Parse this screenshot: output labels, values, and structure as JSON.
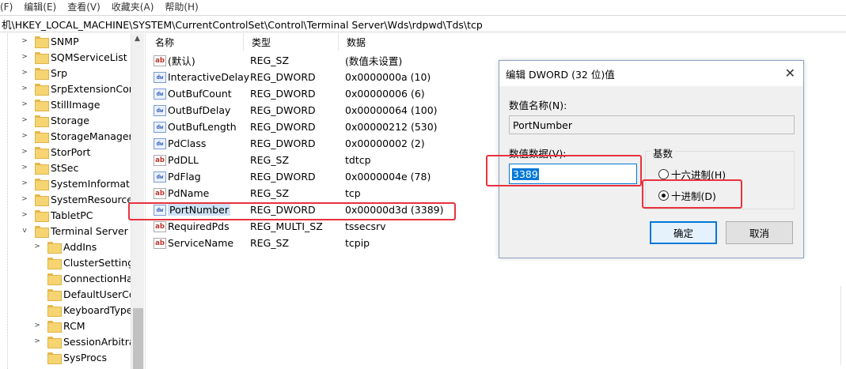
{
  "menu": [
    "(F)",
    "编辑(E)",
    "查看(V)",
    "收藏夹(A)",
    "帮助(H)"
  ],
  "address": "机\\HKEY_LOCAL_MACHINE\\SYSTEM\\CurrentControlSet\\Control\\Terminal Server\\Wds\\rdpwd\\Tds\\tcp",
  "tree": {
    "items": [
      {
        "label": "SNMP",
        "expander": ">"
      },
      {
        "label": "SQMServiceList",
        "expander": ">"
      },
      {
        "label": "Srp",
        "expander": ">"
      },
      {
        "label": "SrpExtensionConf",
        "expander": ">"
      },
      {
        "label": "StillImage",
        "expander": ">"
      },
      {
        "label": "Storage",
        "expander": ">"
      },
      {
        "label": "StorageManagem",
        "expander": ">"
      },
      {
        "label": "StorPort",
        "expander": ">"
      },
      {
        "label": "StSec",
        "expander": ">"
      },
      {
        "label": "SystemInformatio",
        "expander": ">"
      },
      {
        "label": "SystemResources",
        "expander": ">"
      },
      {
        "label": "TabletPC",
        "expander": ">"
      },
      {
        "label": "Terminal Server",
        "expander": "v"
      },
      {
        "label": "AddIns",
        "expander": ">"
      },
      {
        "label": "ClusterSettings",
        "expander": ""
      },
      {
        "label": "ConnectionHan",
        "expander": ""
      },
      {
        "label": "DefaultUserCor",
        "expander": ""
      },
      {
        "label": "KeyboardType",
        "expander": ""
      },
      {
        "label": "RCM",
        "expander": ">"
      },
      {
        "label": "SessionArbitrat",
        "expander": ">"
      },
      {
        "label": "SysProcs",
        "expander": ""
      }
    ]
  },
  "list": {
    "headers": {
      "name": "名称",
      "type": "类型",
      "data": "数据"
    },
    "rows": [
      {
        "icon": "ab",
        "name": "(默认)",
        "type": "REG_SZ",
        "data": "(数值未设置)"
      },
      {
        "icon": "dw",
        "name": "InteractiveDelay",
        "type": "REG_DWORD",
        "data": "0x0000000a (10)"
      },
      {
        "icon": "dw",
        "name": "OutBufCount",
        "type": "REG_DWORD",
        "data": "0x00000006 (6)"
      },
      {
        "icon": "dw",
        "name": "OutBufDelay",
        "type": "REG_DWORD",
        "data": "0x00000064 (100)"
      },
      {
        "icon": "dw",
        "name": "OutBufLength",
        "type": "REG_DWORD",
        "data": "0x00000212 (530)"
      },
      {
        "icon": "dw",
        "name": "PdClass",
        "type": "REG_DWORD",
        "data": "0x00000002 (2)"
      },
      {
        "icon": "ab",
        "name": "PdDLL",
        "type": "REG_SZ",
        "data": "tdtcp"
      },
      {
        "icon": "dw",
        "name": "PdFlag",
        "type": "REG_DWORD",
        "data": "0x0000004e (78)"
      },
      {
        "icon": "ab",
        "name": "PdName",
        "type": "REG_SZ",
        "data": "tcp"
      },
      {
        "icon": "dw",
        "name": "PortNumber",
        "type": "REG_DWORD",
        "data": "0x00000d3d (3389)"
      },
      {
        "icon": "ab",
        "name": "RequiredPds",
        "type": "REG_MULTI_SZ",
        "data": "tssecsrv"
      },
      {
        "icon": "ab",
        "name": "ServiceName",
        "type": "REG_SZ",
        "data": "tcpip"
      }
    ]
  },
  "dialog": {
    "title": "编辑 DWORD (32 位)值",
    "close": "✕",
    "value_name_label": "数值名称(N):",
    "value_name": "PortNumber",
    "value_data_label": "数值数据(V):",
    "value_data": "3389",
    "base_label": "基数",
    "hex_label": "十六进制(H)",
    "dec_label": "十进制(D)",
    "base_selected": "decimal",
    "ok": "确定",
    "cancel": "取消"
  },
  "colors": {
    "highlight": "#e8323d",
    "selection": "#0078d7"
  }
}
